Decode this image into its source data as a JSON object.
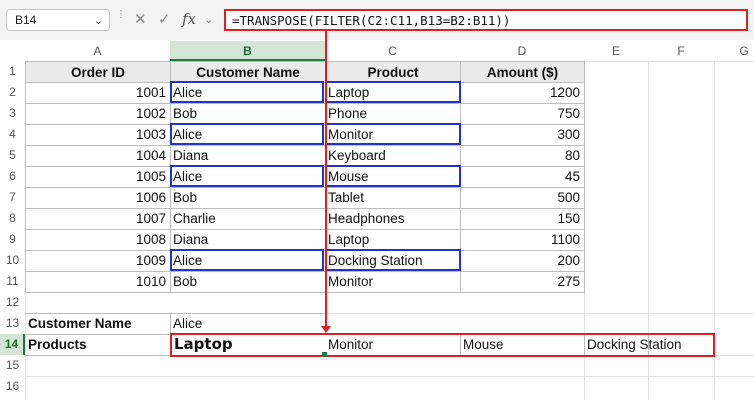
{
  "formula_bar": {
    "name_box": "B14",
    "fx_label": "fx",
    "formula": "=TRANSPOSE(FILTER(C2:C11,B13=B2:B11))"
  },
  "columns": [
    "A",
    "B",
    "C",
    "D",
    "E",
    "F",
    "G"
  ],
  "rows": [
    "1",
    "2",
    "3",
    "4",
    "5",
    "6",
    "7",
    "8",
    "9",
    "10",
    "11",
    "12",
    "13",
    "14",
    "15",
    "16"
  ],
  "table": {
    "headers": [
      "Order ID",
      "Customer Name",
      "Product",
      "Amount ($)"
    ],
    "rows": [
      [
        "1001",
        "Alice",
        "Laptop",
        "1200"
      ],
      [
        "1002",
        "Bob",
        "Phone",
        "750"
      ],
      [
        "1003",
        "Alice",
        "Monitor",
        "300"
      ],
      [
        "1004",
        "Diana",
        "Keyboard",
        "80"
      ],
      [
        "1005",
        "Alice",
        "Mouse",
        "45"
      ],
      [
        "1006",
        "Bob",
        "Tablet",
        "500"
      ],
      [
        "1007",
        "Charlie",
        "Headphones",
        "150"
      ],
      [
        "1008",
        "Diana",
        "Laptop",
        "1100"
      ],
      [
        "1009",
        "Alice",
        "Docking Station",
        "200"
      ],
      [
        "1010",
        "Bob",
        "Monitor",
        "275"
      ]
    ]
  },
  "lookup": {
    "customer_label": "Customer Name",
    "customer_value": "Alice",
    "products_label": "Products",
    "results": [
      "Laptop",
      "Monitor",
      "Mouse",
      "Docking Station"
    ]
  },
  "colors": {
    "highlight": "#2233cc",
    "annotation": "#e02020",
    "selected": "#1e7a3a"
  }
}
